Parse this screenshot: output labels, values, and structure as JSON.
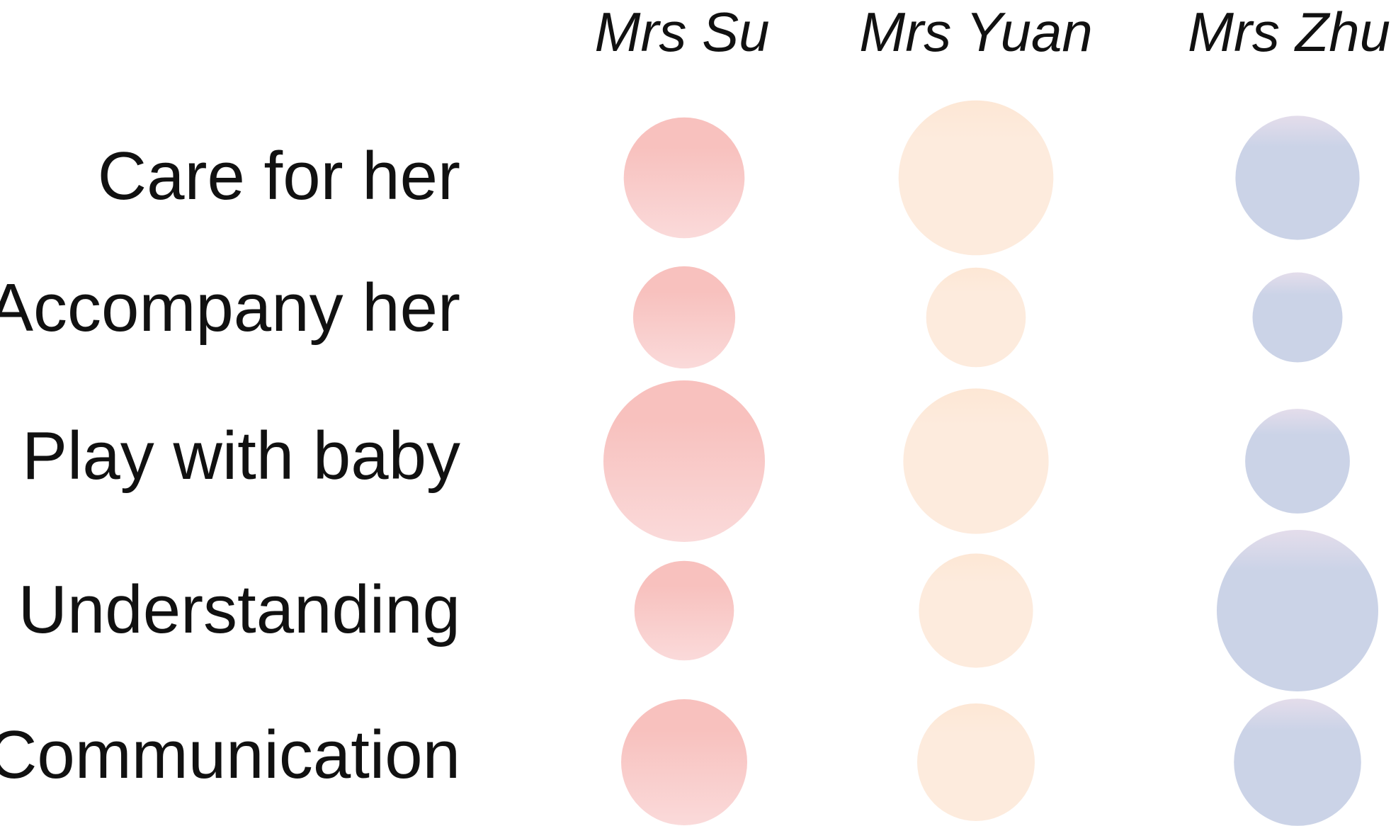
{
  "chart_data": {
    "type": "bubble-matrix",
    "title": "",
    "columns": [
      "Mrs Su",
      "Mrs Yuan",
      "Mrs Zhu"
    ],
    "rows": [
      "Care for her",
      "Accompany her",
      "Play with baby",
      "Understanding",
      "Communication"
    ],
    "series": [
      {
        "name": "Mrs Su",
        "values": [
          0.56,
          0.4,
          1.0,
          0.38,
          0.61
        ],
        "color_top": "#F8C1BE",
        "color_bottom": "#FADADA"
      },
      {
        "name": "Mrs Yuan",
        "values": [
          0.92,
          0.38,
          0.81,
          0.5,
          0.53
        ],
        "color_top": "#FDE7D5",
        "color_bottom": "#FDEBDD"
      },
      {
        "name": "Mrs Zhu",
        "values": [
          0.59,
          0.31,
          0.42,
          1.0,
          0.62
        ],
        "color_top": "#E4DDEB",
        "color_bottom": "#CBD3E7"
      }
    ],
    "value_encoding": "circle area (relative)",
    "legend": "none",
    "grid": false
  }
}
